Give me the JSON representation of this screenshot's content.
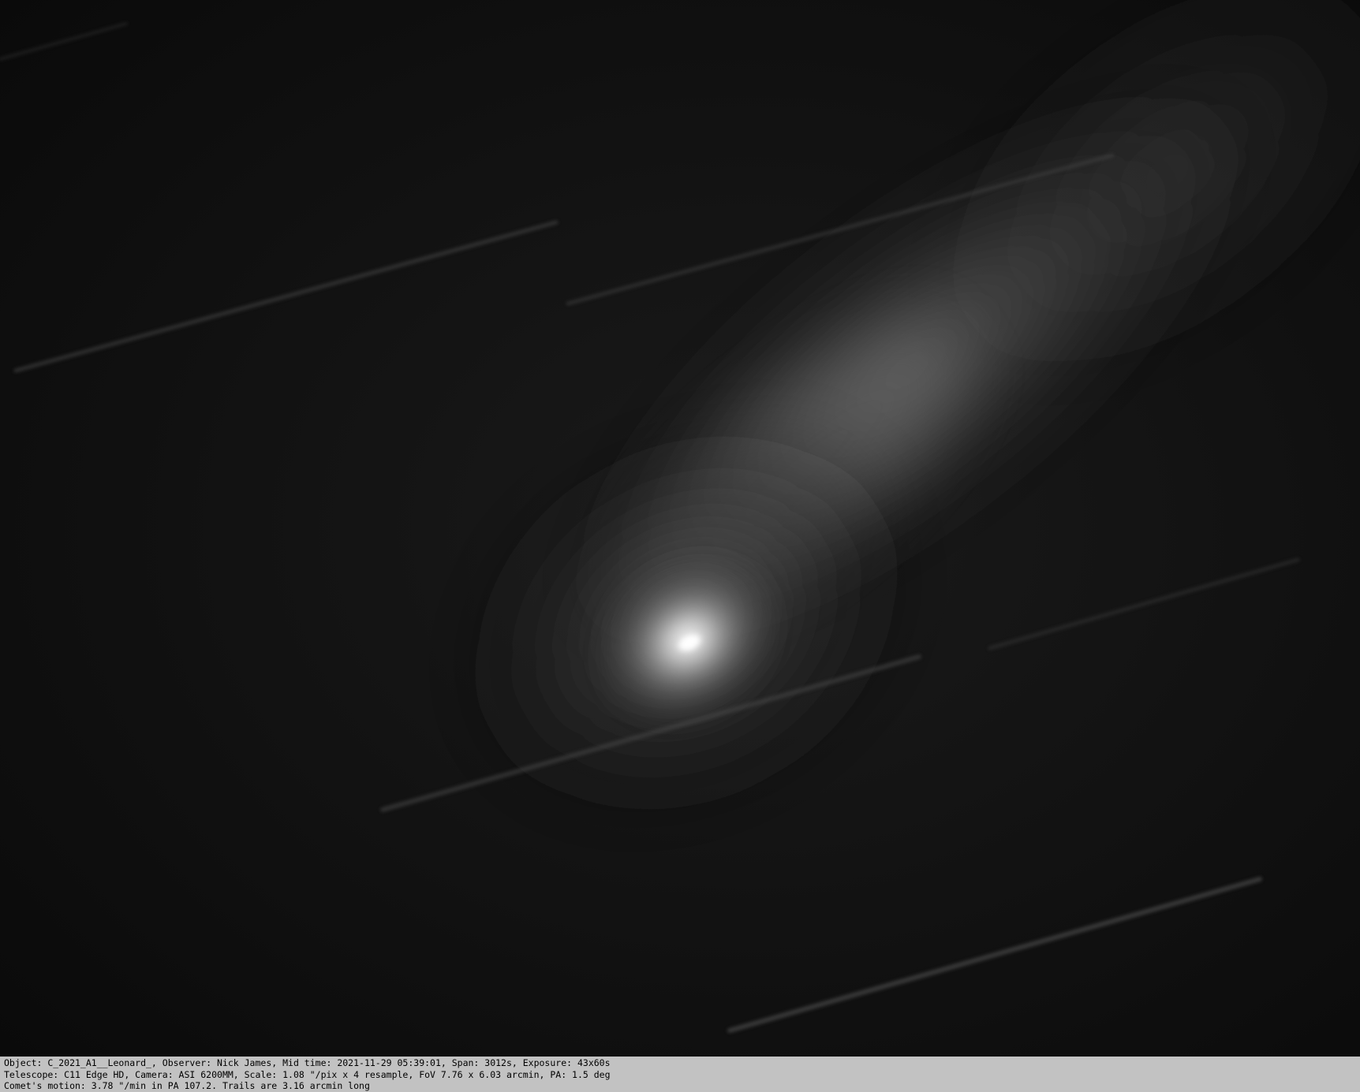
{
  "image": {
    "subject": "comet",
    "background_color": "#0c0c0c",
    "coma_color": "#ffffff",
    "caption_bar_color": "#c2c2c2"
  },
  "caption": {
    "line1": "Object: C_2021_A1__Leonard_, Observer: Nick James, Mid time: 2021-11-29 05:39:01, Span: 3012s, Exposure: 43x60s",
    "line2": "Telescope: C11 Edge HD, Camera: ASI 6200MM, Scale: 1.08 \"/pix x 4 resample, FoV 7.76 x 6.03 arcmin, PA: 1.5 deg",
    "line3": "Comet's motion: 3.78 \"/min in PA 107.2. Trails are 3.16 arcmin long"
  }
}
